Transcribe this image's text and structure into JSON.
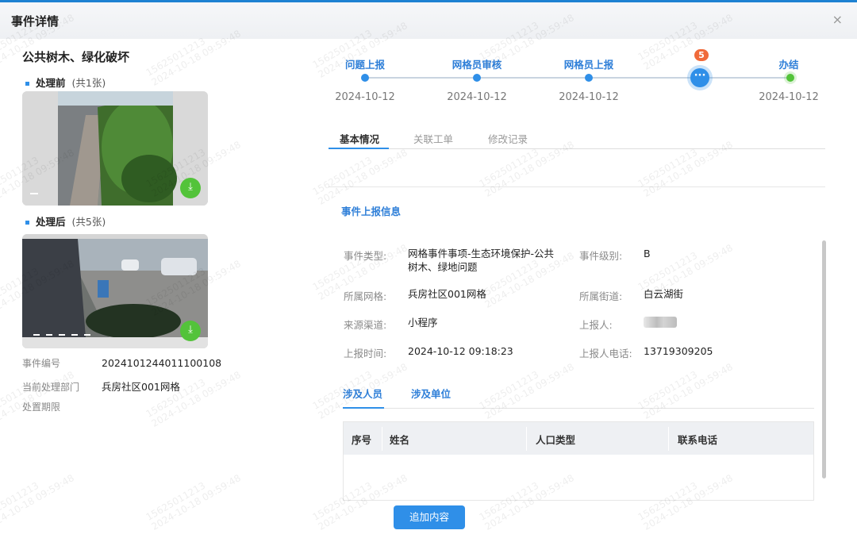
{
  "dialog": {
    "title": "事件详情",
    "close": "×"
  },
  "event": {
    "title": "公共树木、绿化破坏",
    "before": {
      "label": "处理前",
      "count": "(共1张)"
    },
    "after": {
      "label": "处理后",
      "count": "(共5张)"
    },
    "info": [
      {
        "k": "事件编号",
        "v": "2024101244011100108"
      },
      {
        "k": "当前处理部门",
        "v": "兵房社区001网格"
      },
      {
        "k": "处置期限",
        "v": ""
      }
    ]
  },
  "steps": [
    {
      "label": "问题上报",
      "date": "2024-10-12"
    },
    {
      "label": "网格员审核",
      "date": "2024-10-12"
    },
    {
      "label": "网格员上报",
      "date": "2024-10-12"
    },
    {
      "label": "",
      "date": "",
      "badge": "5"
    },
    {
      "label": "办结",
      "date": "2024-10-12"
    }
  ],
  "tabs": [
    "基本情况",
    "关联工单",
    "修改记录"
  ],
  "section_title": "事件上报信息",
  "fields": {
    "type_k": "事件类型:",
    "type_v": "网格事件事项-生态环境保护-公共树木、绿地问题",
    "level_k": "事件级别:",
    "level_v": "B",
    "grid_k": "所属网格:",
    "grid_v": "兵房社区001网格",
    "street_k": "所属街道:",
    "street_v": "白云湖街",
    "source_k": "来源渠道:",
    "source_v": "小程序",
    "reporter_k": "上报人:",
    "reporter_v": "",
    "time_k": "上报时间:",
    "time_v": "2024-10-12 09:18:23",
    "phone_k": "上报人电话:",
    "phone_v": "13719309205"
  },
  "sub_tabs": [
    "涉及人员",
    "涉及单位"
  ],
  "table_headers": [
    "序号",
    "姓名",
    "人口类型",
    "联系电话"
  ],
  "add_button": "追加内容",
  "watermark": {
    "line1": "15625011213",
    "line2": "2024-10-18 09:59:48"
  },
  "colors": {
    "accent": "#2f8fe8",
    "done": "#53c33a",
    "badge": "#f06a3a"
  }
}
